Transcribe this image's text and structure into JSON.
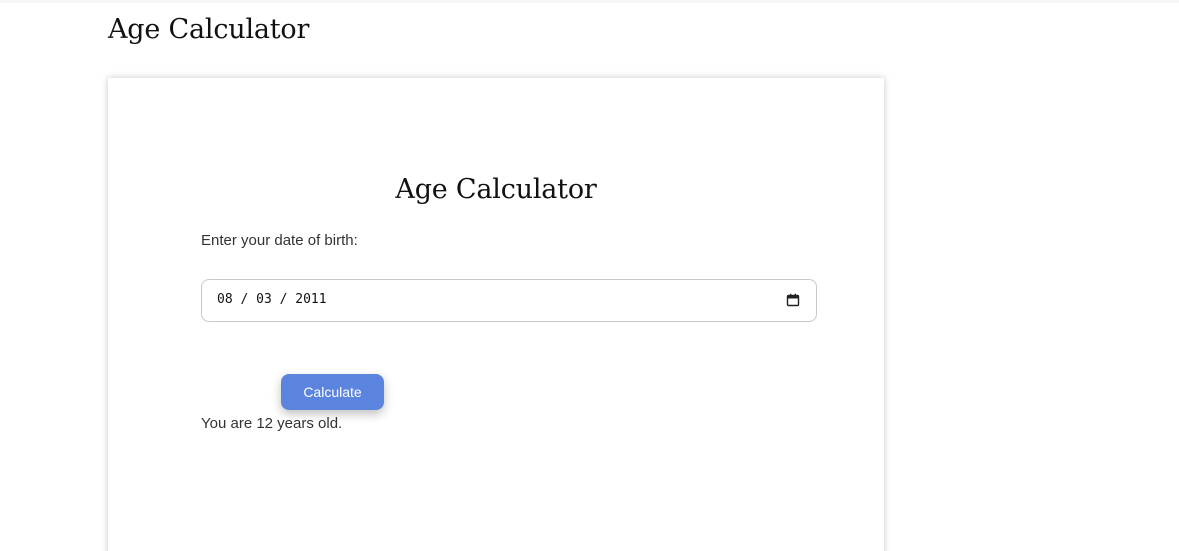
{
  "page": {
    "title": "Age Calculator"
  },
  "card": {
    "title": "Age Calculator",
    "dob_label": "Enter your date of birth:",
    "date_input": {
      "value": "08 / 03 / 2011",
      "icon": "calendar-icon"
    },
    "calculate_button_label": "Calculate",
    "result_text": "You are 12 years old."
  },
  "colors": {
    "accent": "#5b84df",
    "text": "#333333",
    "title": "#111111",
    "border": "#c9c9c9"
  }
}
